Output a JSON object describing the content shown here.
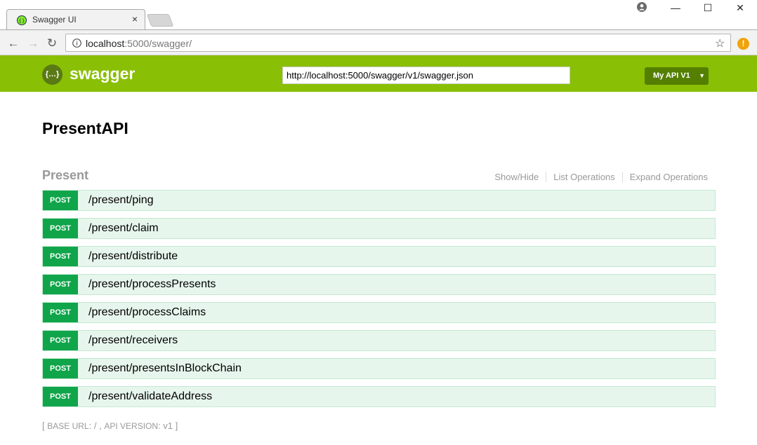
{
  "browser": {
    "tab_title": "Swagger UI",
    "tab_close": "×",
    "url_host": "localhost",
    "url_rest": ":5000/swagger/",
    "window_controls": [
      "—",
      "☐",
      "✕"
    ]
  },
  "header": {
    "logo_text": "swagger",
    "logo_glyph": "{…}",
    "spec_url": "http://localhost:5000/swagger/v1/swagger.json",
    "version_select": "My API V1",
    "accent": "#89bf04"
  },
  "main": {
    "api_title": "PresentAPI",
    "resource": {
      "name": "Present",
      "actions": [
        "Show/Hide",
        "List Operations",
        "Expand Operations"
      ],
      "operations": [
        {
          "method": "POST",
          "path": "/present/ping"
        },
        {
          "method": "POST",
          "path": "/present/claim"
        },
        {
          "method": "POST",
          "path": "/present/distribute"
        },
        {
          "method": "POST",
          "path": "/present/processPresents"
        },
        {
          "method": "POST",
          "path": "/present/processClaims"
        },
        {
          "method": "POST",
          "path": "/present/receivers"
        },
        {
          "method": "POST",
          "path": "/present/presentsInBlockChain"
        },
        {
          "method": "POST",
          "path": "/present/validateAddress"
        }
      ]
    },
    "footer": {
      "open": "[",
      "base_url_label": "Base URL",
      "base_url_value": "/",
      "sep": ",",
      "api_version_label": "Api Version",
      "api_version_value": "v1",
      "close": "]"
    }
  }
}
